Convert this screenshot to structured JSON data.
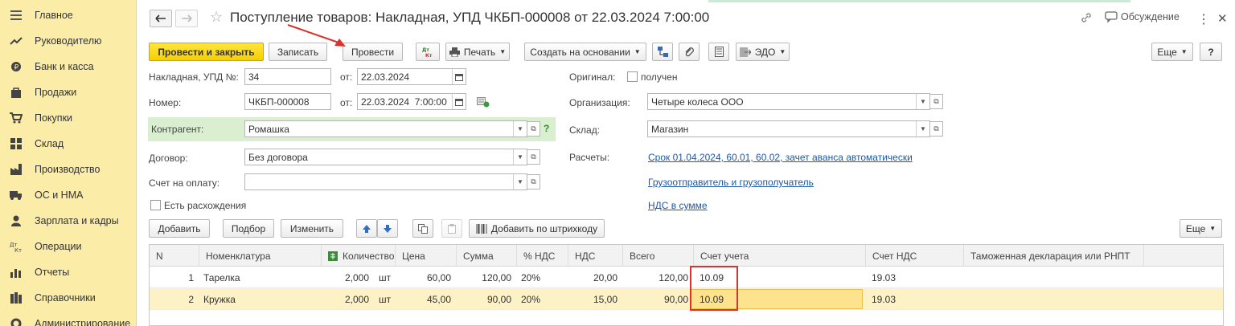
{
  "sidebar": {
    "items": [
      {
        "label": "Главное",
        "icon": "menu-icon"
      },
      {
        "label": "Руководителю",
        "icon": "trend-icon"
      },
      {
        "label": "Банк и касса",
        "icon": "coin-icon"
      },
      {
        "label": "Продажи",
        "icon": "bag-icon"
      },
      {
        "label": "Покупки",
        "icon": "cart-icon"
      },
      {
        "label": "Склад",
        "icon": "warehouse-icon"
      },
      {
        "label": "Производство",
        "icon": "factory-icon"
      },
      {
        "label": "ОС и НМА",
        "icon": "truck-icon"
      },
      {
        "label": "Зарплата и кадры",
        "icon": "person-icon"
      },
      {
        "label": "Операции",
        "icon": "dt-kt-icon"
      },
      {
        "label": "Отчеты",
        "icon": "bar-chart-icon"
      },
      {
        "label": "Справочники",
        "icon": "books-icon"
      },
      {
        "label": "Администрирование",
        "icon": "gear-icon"
      }
    ]
  },
  "header": {
    "title": "Поступление товаров: Накладная, УПД ЧКБП-000008 от 22.03.2024 7:00:00",
    "discussion": "Обсуждение"
  },
  "toolbar": {
    "post_close": "Провести и закрыть",
    "save": "Записать",
    "post": "Провести",
    "print": "Печать",
    "create_based": "Создать на основании",
    "edo": "ЭДО",
    "more": "Еще",
    "help": "?"
  },
  "form": {
    "invoice_label": "Накладная, УПД №:",
    "invoice_value": "34",
    "from_label": "от:",
    "invoice_date": "22.03.2024",
    "number_label": "Номер:",
    "number_value": "ЧКБП-000008",
    "number_date": "22.03.2024  7:00:00",
    "counterparty_label": "Контрагент:",
    "counterparty_value": "Ромашка",
    "help_mark": "?",
    "contract_label": "Договор:",
    "contract_value": "Без договора",
    "payment_label": "Счет на оплату:",
    "payment_value": "",
    "discrepancy_label": "Есть расхождения",
    "original_label": "Оригинал:",
    "original_received": "получен",
    "org_label": "Организация:",
    "org_value": "Четыре колеса ООО",
    "warehouse_label": "Склад:",
    "warehouse_value": "Магазин",
    "settlements_label": "Расчеты:",
    "settlements_link": "Срок 01.04.2024, 60.01, 60.02, зачет аванса автоматически",
    "shipper_link": "Грузоотправитель и грузополучатель",
    "vat_link": "НДС в сумме"
  },
  "table_toolbar": {
    "add": "Добавить",
    "pick": "Подбор",
    "edit": "Изменить",
    "barcode": "Добавить по штрихкоду",
    "more": "Еще"
  },
  "table": {
    "columns": [
      "N",
      "Номенклатура",
      "Количество",
      "Цена",
      "Сумма",
      "% НДС",
      "НДС",
      "Всего",
      "Счет учета",
      "Счет НДС",
      "Таможенная декларация или РНПТ"
    ],
    "rows": [
      {
        "n": "1",
        "name": "Тарелка",
        "qty": "2,000",
        "unit": "шт",
        "price": "60,00",
        "sum": "120,00",
        "vat_rate": "20%",
        "vat": "20,00",
        "total": "120,00",
        "account": "10.09",
        "vat_account": "19.03"
      },
      {
        "n": "2",
        "name": "Кружка",
        "qty": "2,000",
        "unit": "шт",
        "price": "45,00",
        "sum": "90,00",
        "vat_rate": "20%",
        "vat": "15,00",
        "total": "90,00",
        "account": "10.09",
        "vat_account": "19.03"
      }
    ]
  },
  "colors": {
    "sidebar_bg": "#fbeca8",
    "primary_button": "#f5cf00",
    "highlight_red": "#d6342c",
    "counterparty_bg": "#d9efcf",
    "link": "#1c58a8"
  }
}
